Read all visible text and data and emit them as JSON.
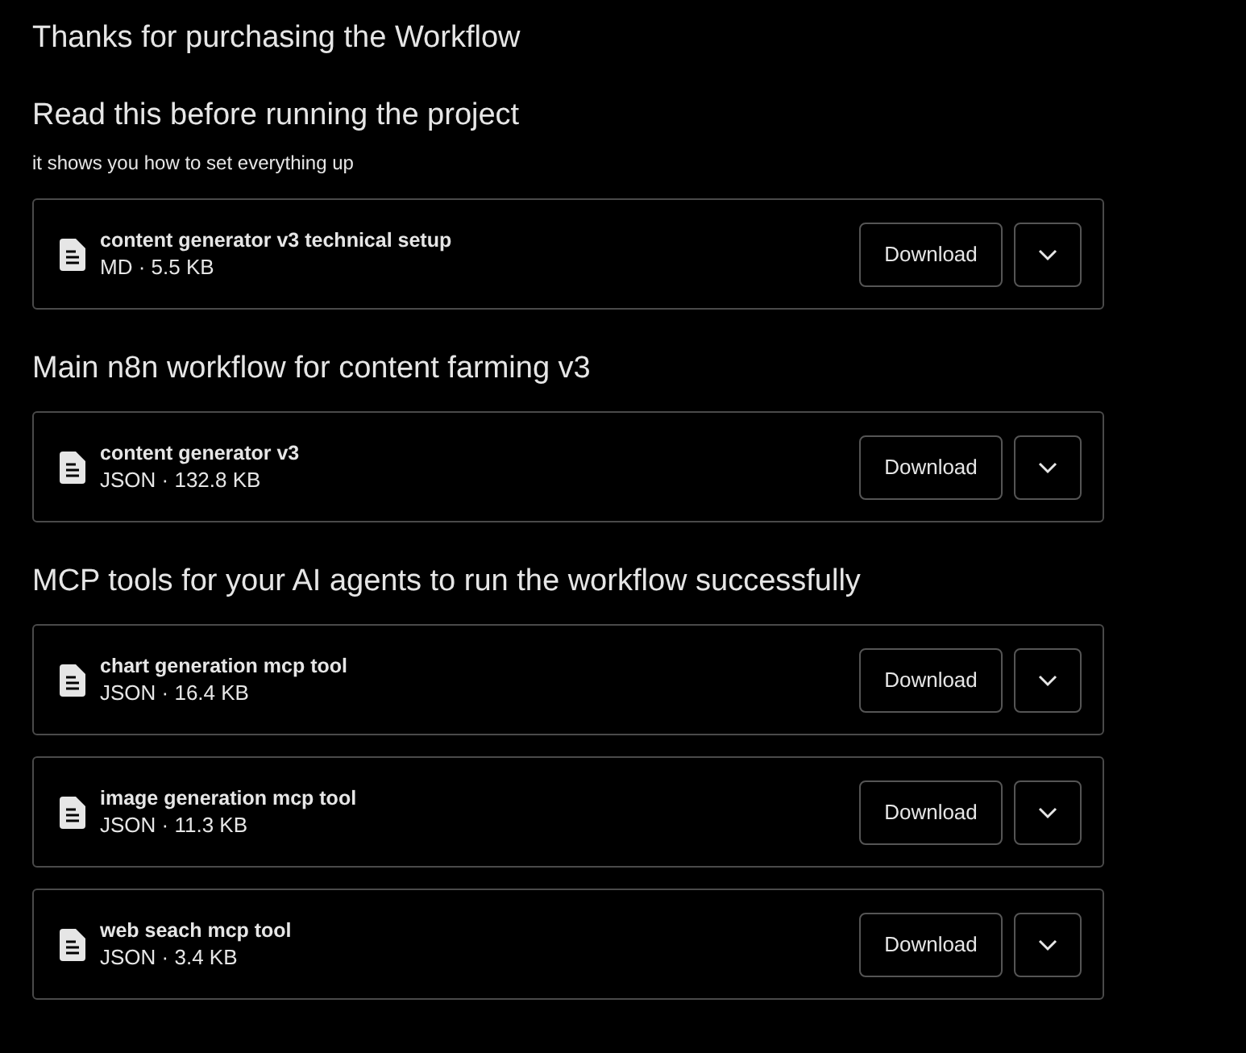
{
  "title": "Thanks for purchasing the Workflow",
  "sections": [
    {
      "heading": "Read this before running the project",
      "note": "it shows you how to set everything up",
      "files": [
        {
          "name": "content generator v3 technical setup",
          "meta": "MD · 5.5 KB",
          "button": "Download"
        }
      ]
    },
    {
      "heading": "Main n8n workflow for content farming v3",
      "files": [
        {
          "name": "content generator v3",
          "meta": "JSON · 132.8 KB",
          "button": "Download"
        }
      ]
    },
    {
      "heading": "MCP tools for your AI agents to run the workflow successfully",
      "files": [
        {
          "name": "chart generation mcp tool",
          "meta": "JSON · 16.4 KB",
          "button": "Download"
        },
        {
          "name": "image generation mcp tool",
          "meta": "JSON · 11.3 KB",
          "button": "Download"
        },
        {
          "name": "web seach mcp tool",
          "meta": "JSON · 3.4 KB",
          "button": "Download"
        }
      ]
    }
  ]
}
